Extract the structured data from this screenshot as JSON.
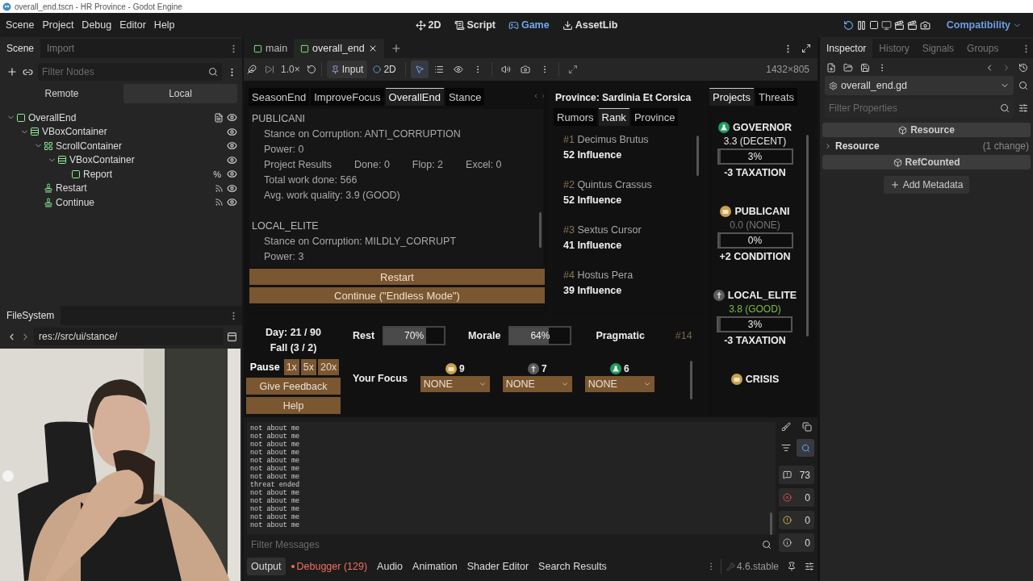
{
  "window": {
    "title": "overall_end.tscn - HR Province - Godot Engine"
  },
  "menu": [
    "Scene",
    "Project",
    "Debug",
    "Editor",
    "Help"
  ],
  "workspaces": [
    {
      "label": "2D",
      "kind": "move",
      "selected": false
    },
    {
      "label": "Script",
      "kind": "script",
      "selected": false
    },
    {
      "label": "Game",
      "kind": "game",
      "selected": true
    },
    {
      "label": "AssetLib",
      "kind": "download",
      "selected": false
    }
  ],
  "renderer": "Compatibility",
  "scene_dock": {
    "tabs": [
      {
        "label": "Scene",
        "selected": true
      },
      {
        "label": "Import",
        "selected": false
      }
    ],
    "filter_placeholder": "Filter Nodes",
    "modes": [
      {
        "label": "Remote",
        "selected": false
      },
      {
        "label": "Local",
        "selected": true
      }
    ],
    "tree": [
      {
        "label": "OverallEnd",
        "kind": "control",
        "script": true,
        "expanded": true,
        "children": [
          {
            "label": "VBoxContainer",
            "kind": "vbox",
            "expanded": true,
            "children": [
              {
                "label": "ScrollContainer",
                "kind": "scroll",
                "expanded": true,
                "children": [
                  {
                    "label": "VBoxContainer",
                    "kind": "vbox",
                    "expanded": true,
                    "children": [
                      {
                        "label": "Report",
                        "kind": "control",
                        "unique": "%"
                      }
                    ]
                  }
                ]
              },
              {
                "label": "Restart",
                "kind": "button",
                "signals": true
              },
              {
                "label": "Continue",
                "kind": "button",
                "signals": true
              }
            ]
          }
        ]
      }
    ]
  },
  "filesystem": {
    "title": "FileSystem",
    "path": "res://src/ui/stance/"
  },
  "webcam": {
    "kind": "picture"
  },
  "editor_tabs": [
    {
      "label": "main",
      "selected": false
    },
    {
      "label": "overall_end",
      "selected": true
    }
  ],
  "game_toolbar": {
    "speed": "1.0×",
    "input": "Input",
    "mode": "2D",
    "resolution": "1432×805"
  },
  "game": {
    "report_tabs": [
      {
        "label": "SeasonEnd",
        "selected": false
      },
      {
        "label": "ImproveFocus",
        "selected": false
      },
      {
        "label": "OverallEnd",
        "selected": true
      },
      {
        "label": "Stance",
        "selected": false
      }
    ],
    "report": [
      {
        "name": "PUBLICANI",
        "lines": [
          [
            "Stance on Corruption: ANTI_CORRUPTION"
          ],
          [
            "Power: 0"
          ],
          [
            "Project Results",
            "Done: 0",
            "Flop: 2",
            "Excel: 0"
          ],
          [
            "Total work done: 566"
          ],
          [
            "Avg. work quality: 3.9 (GOOD)"
          ]
        ]
      },
      {
        "name": "LOCAL_ELITE",
        "lines": [
          [
            "Stance on Corruption: MILDLY_CORRUPT"
          ],
          [
            "Power: 3"
          ]
        ]
      }
    ],
    "buttons": [
      "Restart",
      "Continue (\"Endless Mode\")"
    ],
    "province": {
      "title": "Province: Sardinia Et Corsica",
      "tabs": [
        {
          "label": "Rumors",
          "selected": false
        },
        {
          "label": "Rank",
          "selected": true
        },
        {
          "label": "Province",
          "selected": false
        }
      ],
      "ranks": [
        {
          "rank": "#1",
          "name": "Decimus Brutus",
          "influence": "52 Influence"
        },
        {
          "rank": "#2",
          "name": "Quintus Crassus",
          "influence": "52 Influence"
        },
        {
          "rank": "#3",
          "name": "Sextus Cursor",
          "influence": "41 Influence"
        },
        {
          "rank": "#4",
          "name": "Hostus Pera",
          "influence": "39 Influence"
        }
      ]
    },
    "projects": {
      "tabs": [
        {
          "label": "Projects",
          "selected": true
        },
        {
          "label": "Threats",
          "selected": false
        }
      ],
      "items": [
        {
          "faction": "GOVERNOR",
          "kind": "governor",
          "rating": "3.3 (DECENT)",
          "color": "#e6e6e6",
          "progress": "3%",
          "level": 0.03,
          "effect": "-3 TAXATION"
        },
        {
          "faction": "PUBLICANI",
          "kind": "publicani",
          "rating": "0.0 (NONE)",
          "color": "#777777",
          "progress": "0%",
          "level": 0,
          "effect": "+2 CONDITION"
        },
        {
          "faction": "LOCAL_ELITE",
          "kind": "elite",
          "rating": "3.8 (GOOD)",
          "color": "#7fb84a",
          "progress": "3%",
          "level": 0.03,
          "effect": "-3 TAXATION"
        },
        {
          "faction": "CRISIS",
          "kind": "publicani"
        }
      ]
    },
    "clock": {
      "day": "Day: 21 / 90",
      "season": "Fall (3 / 2)",
      "speeds": [
        {
          "label": "Pause",
          "selected": true
        },
        {
          "label": "1x",
          "selected": false
        },
        {
          "label": "5x",
          "selected": false
        },
        {
          "label": "20x",
          "selected": false
        }
      ]
    },
    "side_buttons": [
      "Give Feedback",
      "Help"
    ],
    "meters": [
      {
        "label": "Rest",
        "reading": "70%",
        "level": 0.7
      },
      {
        "label": "Morale",
        "reading": "64%",
        "level": 0.64
      }
    ],
    "stance": {
      "label": "Pragmatic",
      "rank": "#14"
    },
    "focus": {
      "label": "Your Focus",
      "slots": [
        {
          "kind": "publicani",
          "count": "9",
          "value": "NONE"
        },
        {
          "kind": "elite",
          "count": "7",
          "value": "NONE"
        },
        {
          "kind": "governor",
          "count": "6",
          "value": "NONE"
        }
      ]
    }
  },
  "output": {
    "lines": [
      "not about me",
      "not about me",
      "not about me",
      "not about me",
      "not about me",
      "not about me",
      "not about me",
      "threat ended",
      "not about me",
      "not about me",
      "not about me",
      "not about me",
      "not about me"
    ],
    "filter_placeholder": "Filter Messages",
    "counters": [
      {
        "kind": "messages",
        "count": "73"
      },
      {
        "kind": "error",
        "count": "0"
      },
      {
        "kind": "warning",
        "count": "0"
      },
      {
        "kind": "info",
        "count": "0"
      }
    ]
  },
  "bottom_panel": {
    "tabs": [
      {
        "label": "Output",
        "selected": true,
        "alert": false
      },
      {
        "label": "Debugger (129)",
        "selected": false,
        "alert": true
      },
      {
        "label": "Audio",
        "selected": false,
        "alert": false
      },
      {
        "label": "Animation",
        "selected": false,
        "alert": false
      },
      {
        "label": "Shader Editor",
        "selected": false,
        "alert": false
      },
      {
        "label": "Search Results",
        "selected": false,
        "alert": false
      }
    ],
    "version": "4.6.stable"
  },
  "inspector": {
    "tabs": [
      {
        "label": "Inspector",
        "selected": true
      },
      {
        "label": "History",
        "selected": false
      },
      {
        "label": "Signals",
        "selected": false
      },
      {
        "label": "Groups",
        "selected": false
      }
    ],
    "resource": "overall_end.gd",
    "filter_placeholder": "Filter Properties",
    "sections": [
      {
        "kind": "category",
        "label": "Resource"
      },
      {
        "kind": "group",
        "label": "Resource",
        "note": "(1 change)"
      },
      {
        "kind": "category",
        "label": "RefCounted"
      }
    ],
    "add_button": "Add Metadata"
  }
}
